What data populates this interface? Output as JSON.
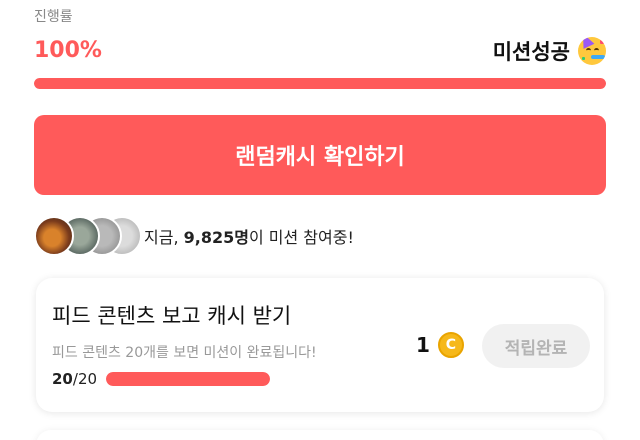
{
  "progress": {
    "label": "진행률",
    "value_text": "100%",
    "fraction": 1.0,
    "status_text": "미션성공",
    "status_icon": "party-face-icon"
  },
  "cta": {
    "label": "랜덤캐시 확인하기"
  },
  "participants": {
    "prefix": "지금, ",
    "count": "9,825명",
    "suffix": "이 미션 참여중!",
    "avatar_count": 4
  },
  "mission": {
    "title": "피드 콘텐츠 보고 캐시 받기",
    "description": "피드 콘텐츠 20개를 보면 미션이 완료됩니다!",
    "current": "20",
    "separator": "/",
    "total": "20",
    "count_fraction": 1.0,
    "reward_amount": "1",
    "coin_letter": "C",
    "button_label": "적립완료"
  },
  "colors": {
    "accent": "#ff5a5a",
    "coin": "#f6b81a",
    "disabled_bg": "#f1f1f1",
    "disabled_text": "#b4b4b4"
  }
}
